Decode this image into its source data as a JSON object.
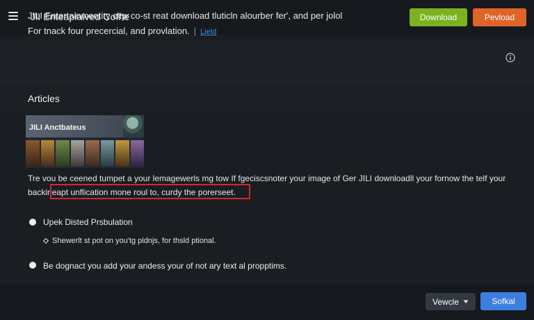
{
  "header": {
    "app_title": "JlI Enteapiaived Cofhe",
    "download_label": "Download",
    "pevload_label": "Pevload",
    "download_color": "#7ab31f",
    "pevload_color": "#de6428"
  },
  "intro": {
    "line1": "JILI Entertainmentity city, co-st reat download tluticln alourber fer', and per jolol",
    "line2": "For tnack four precercial, and provlation.",
    "link": "Lield"
  },
  "articles": {
    "title": "Articles",
    "banner_title": "JILI Anctbateus"
  },
  "content": {
    "paragraph_line1": "Tre vou be ceened tumpet a your lemagewerls mg tow If fgeciscsnoter your image of Ger JILI downloadll your fornow the telf your",
    "paragraph_line2": "backineapt unflication mone roul to, curdy the porerseet."
  },
  "options": [
    {
      "label": "Upek Disted Prsbulation"
    },
    {
      "label": "Be dognact you add your andess your of not ary text al propptims."
    }
  ],
  "sub_option": {
    "label": "Shewerlt st pot on you'tg pldnjs, for thsld ptional."
  },
  "footer": {
    "vewcle_label": "Vewcle",
    "sofkal_label": "Sofkal",
    "sofkal_color": "#3d7fe0"
  },
  "highlight_color": "#d7262e"
}
